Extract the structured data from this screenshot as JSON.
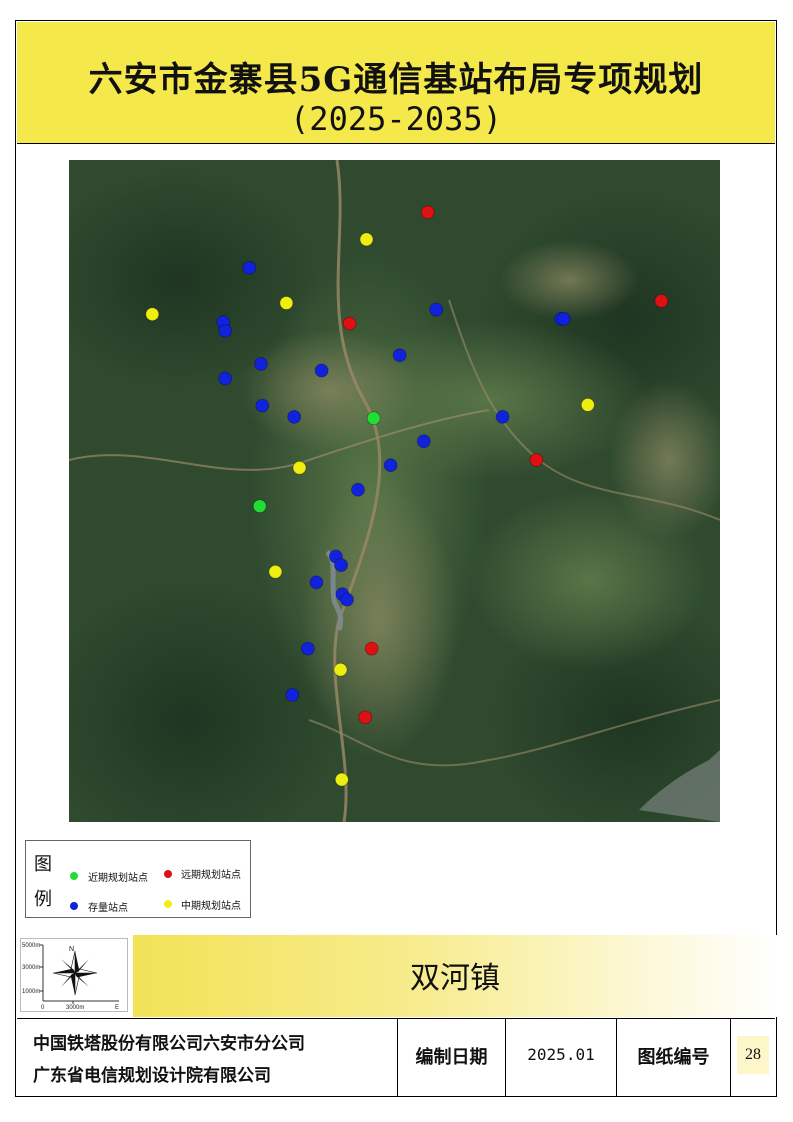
{
  "title": {
    "line1": "六安市金寨县5G通信基站布局专项规划",
    "line2": "(2025-2035)"
  },
  "legend": {
    "title_char_1": "图",
    "title_char_2": "例",
    "items": [
      {
        "label": "近期规划站点",
        "color": "#22dd33",
        "icon": "green-dot"
      },
      {
        "label": "远期规划站点",
        "color": "#dd1111",
        "icon": "red-dot"
      },
      {
        "label": "存量站点",
        "color": "#1122dd",
        "icon": "blue-dot"
      },
      {
        "label": "中期规划站点",
        "color": "#eeee11",
        "icon": "yellow-dot"
      }
    ]
  },
  "compass": {
    "north_label": "N",
    "scale_labels": [
      "5000m",
      "3000m",
      "1000m"
    ],
    "bottom_labels": [
      "0",
      "3000m",
      "E"
    ]
  },
  "town_name": "双河镇",
  "footer": {
    "org_line1": "中国铁塔股份有限公司六安市分公司",
    "org_line2": "广东省电信规划设计院有限公司",
    "date_label": "编制日期",
    "date_value": "2025.01",
    "sheet_label": "图纸编号",
    "sheet_number": "28"
  },
  "map_data": {
    "image": "satellite-imagery",
    "stations": {
      "existing": [
        [
          0.277,
          0.163
        ],
        [
          0.237,
          0.245
        ],
        [
          0.24,
          0.258
        ],
        [
          0.295,
          0.308
        ],
        [
          0.24,
          0.33
        ],
        [
          0.388,
          0.318
        ],
        [
          0.508,
          0.295
        ],
        [
          0.564,
          0.226
        ],
        [
          0.756,
          0.24
        ],
        [
          0.76,
          0.24
        ],
        [
          0.297,
          0.371
        ],
        [
          0.346,
          0.388
        ],
        [
          0.666,
          0.388
        ],
        [
          0.545,
          0.425
        ],
        [
          0.494,
          0.461
        ],
        [
          0.444,
          0.498
        ],
        [
          0.41,
          0.599
        ],
        [
          0.418,
          0.612
        ],
        [
          0.38,
          0.638
        ],
        [
          0.42,
          0.656
        ],
        [
          0.427,
          0.664
        ],
        [
          0.367,
          0.738
        ],
        [
          0.343,
          0.808
        ]
      ],
      "near_term": [
        [
          0.468,
          0.39
        ],
        [
          0.293,
          0.523
        ]
      ],
      "mid_term": [
        [
          0.457,
          0.12
        ],
        [
          0.128,
          0.233
        ],
        [
          0.334,
          0.216
        ],
        [
          0.797,
          0.37
        ],
        [
          0.354,
          0.465
        ],
        [
          0.317,
          0.622
        ],
        [
          0.417,
          0.77
        ],
        [
          0.419,
          0.936
        ]
      ],
      "long_term": [
        [
          0.551,
          0.079
        ],
        [
          0.91,
          0.213
        ],
        [
          0.431,
          0.247
        ],
        [
          0.718,
          0.453
        ],
        [
          0.465,
          0.738
        ],
        [
          0.455,
          0.842
        ]
      ]
    }
  }
}
